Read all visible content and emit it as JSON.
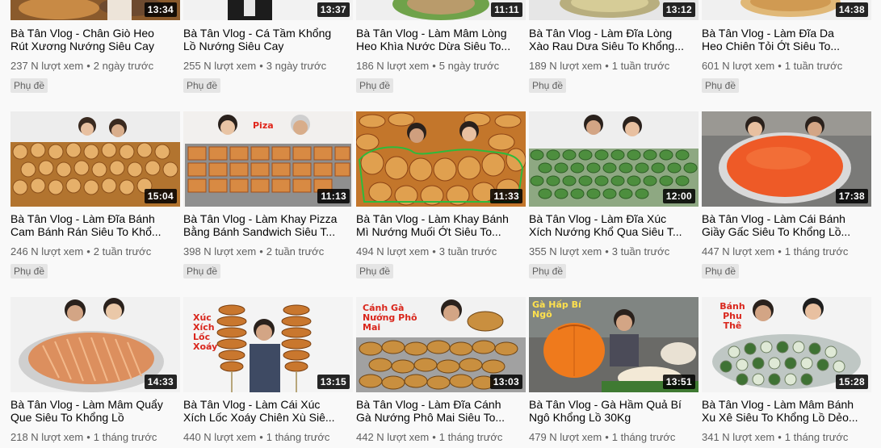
{
  "subtitle_badge": "Phụ đề",
  "colors": {
    "duration_bg": "#000000",
    "badge_bg": "#e5e5e5",
    "meta_text": "#606060"
  },
  "rows": [
    {
      "videos": [
        {
          "duration": "13:34",
          "title_line1": "Bà Tân Vlog - Chân Giò Heo",
          "title_line2": "Rút Xương Nướng Siêu Cay",
          "views": "237 N lượt xem",
          "age": "2 ngày trước",
          "badge": "Phụ đề"
        },
        {
          "duration": "13:37",
          "title_line1": "Bà Tân Vlog - Cá Tầm Khổng",
          "title_line2": "Lồ Nướng Siêu Cay",
          "views": "255 N lượt xem",
          "age": "3 ngày trước",
          "badge": "Phụ đề"
        },
        {
          "duration": "11:11",
          "title_line1": "Bà Tân Vlog - Làm Mâm Lòng",
          "title_line2": "Heo Khìa Nước Dừa Siêu To...",
          "views": "186 N lượt xem",
          "age": "5 ngày trước",
          "badge": "Phụ đề"
        },
        {
          "duration": "13:12",
          "title_line1": "Bà Tân Vlog - Làm Đĩa Lòng",
          "title_line2": "Xào Rau Dưa Siêu To Khổng...",
          "views": "189 N lượt xem",
          "age": "1 tuần trước",
          "badge": "Phụ đề"
        },
        {
          "duration": "14:38",
          "title_line1": "Bà Tân Vlog - Làm Đĩa Da",
          "title_line2": "Heo Chiên Tỏi Ớt Siêu To...",
          "views": "601 N lượt xem",
          "age": "1 tuần trước",
          "badge": "Phụ đề"
        }
      ]
    },
    {
      "videos": [
        {
          "duration": "15:04",
          "title_line1": "Bà Tân Vlog - Làm Đĩa Bánh",
          "title_line2": "Cam Bánh Rán Siêu To Khổ...",
          "views": "246 N lượt xem",
          "age": "2 tuần trước",
          "badge": "Phụ đề"
        },
        {
          "duration": "11:13",
          "thumb_text": "Piza",
          "title_line1": "Bà Tân Vlog - Làm Khay Pizza",
          "title_line2": "Bằng Bánh Sandwich Siêu T...",
          "views": "398 N lượt xem",
          "age": "2 tuần trước",
          "badge": "Phụ đề"
        },
        {
          "duration": "11:33",
          "title_line1": "Bà Tân Vlog - Làm Khay Bánh",
          "title_line2": "Mì Nướng Muối Ớt Siêu To...",
          "views": "494 N lượt xem",
          "age": "3 tuần trước",
          "badge": "Phụ đề"
        },
        {
          "duration": "12:00",
          "title_line1": "Bà Tân Vlog - Làm Đĩa Xúc",
          "title_line2": "Xích Nướng Khổ Qua Siêu T...",
          "views": "355 N lượt xem",
          "age": "3 tuần trước",
          "badge": "Phụ đề"
        },
        {
          "duration": "17:38",
          "title_line1": "Bà Tân Vlog - Làm Cái Bánh",
          "title_line2": "Giầy Gấc Siêu To Khổng Lồ...",
          "views": "447 N lượt xem",
          "age": "1 tháng trước",
          "badge": "Phụ đề"
        }
      ]
    },
    {
      "videos": [
        {
          "duration": "14:33",
          "title_line1": "Bà Tân Vlog - Làm Mâm Quẩy",
          "title_line2": "Que Siêu To Khổng Lồ",
          "views": "218 N lượt xem",
          "age": "1 tháng trước"
        },
        {
          "duration": "13:15",
          "thumb_text": "Xúc Xích Lốc Xoáy",
          "title_line1": "Bà Tân Vlog - Làm Cái Xúc",
          "title_line2": "Xích Lốc Xoáy Chiên Xù Siê...",
          "views": "440 N lượt xem",
          "age": "1 tháng trước"
        },
        {
          "duration": "13:03",
          "thumb_text": "Cánh Gà Nướng Phô Mai",
          "title_line1": "Bà Tân Vlog - Làm Đĩa Cánh",
          "title_line2": "Gà Nướng Phô Mai Siêu To...",
          "views": "442 N lượt xem",
          "age": "1 tháng trước"
        },
        {
          "duration": "13:51",
          "thumb_text": "Gà Hấp Bí Ngô",
          "title_line1": "Bà Tân Vlog - Gà Hầm Quả Bí",
          "title_line2": "Ngô Khổng Lồ 30Kg",
          "views": "479 N lượt xem",
          "age": "1 tháng trước"
        },
        {
          "duration": "15:28",
          "thumb_text": "Bánh Phu Thê",
          "title_line1": "Bà Tân Vlog - Làm Mâm Bánh",
          "title_line2": "Xu Xê Siêu To Khổng Lồ Dẻo...",
          "views": "341 N lượt xem",
          "age": "1 tháng trước"
        }
      ]
    }
  ]
}
